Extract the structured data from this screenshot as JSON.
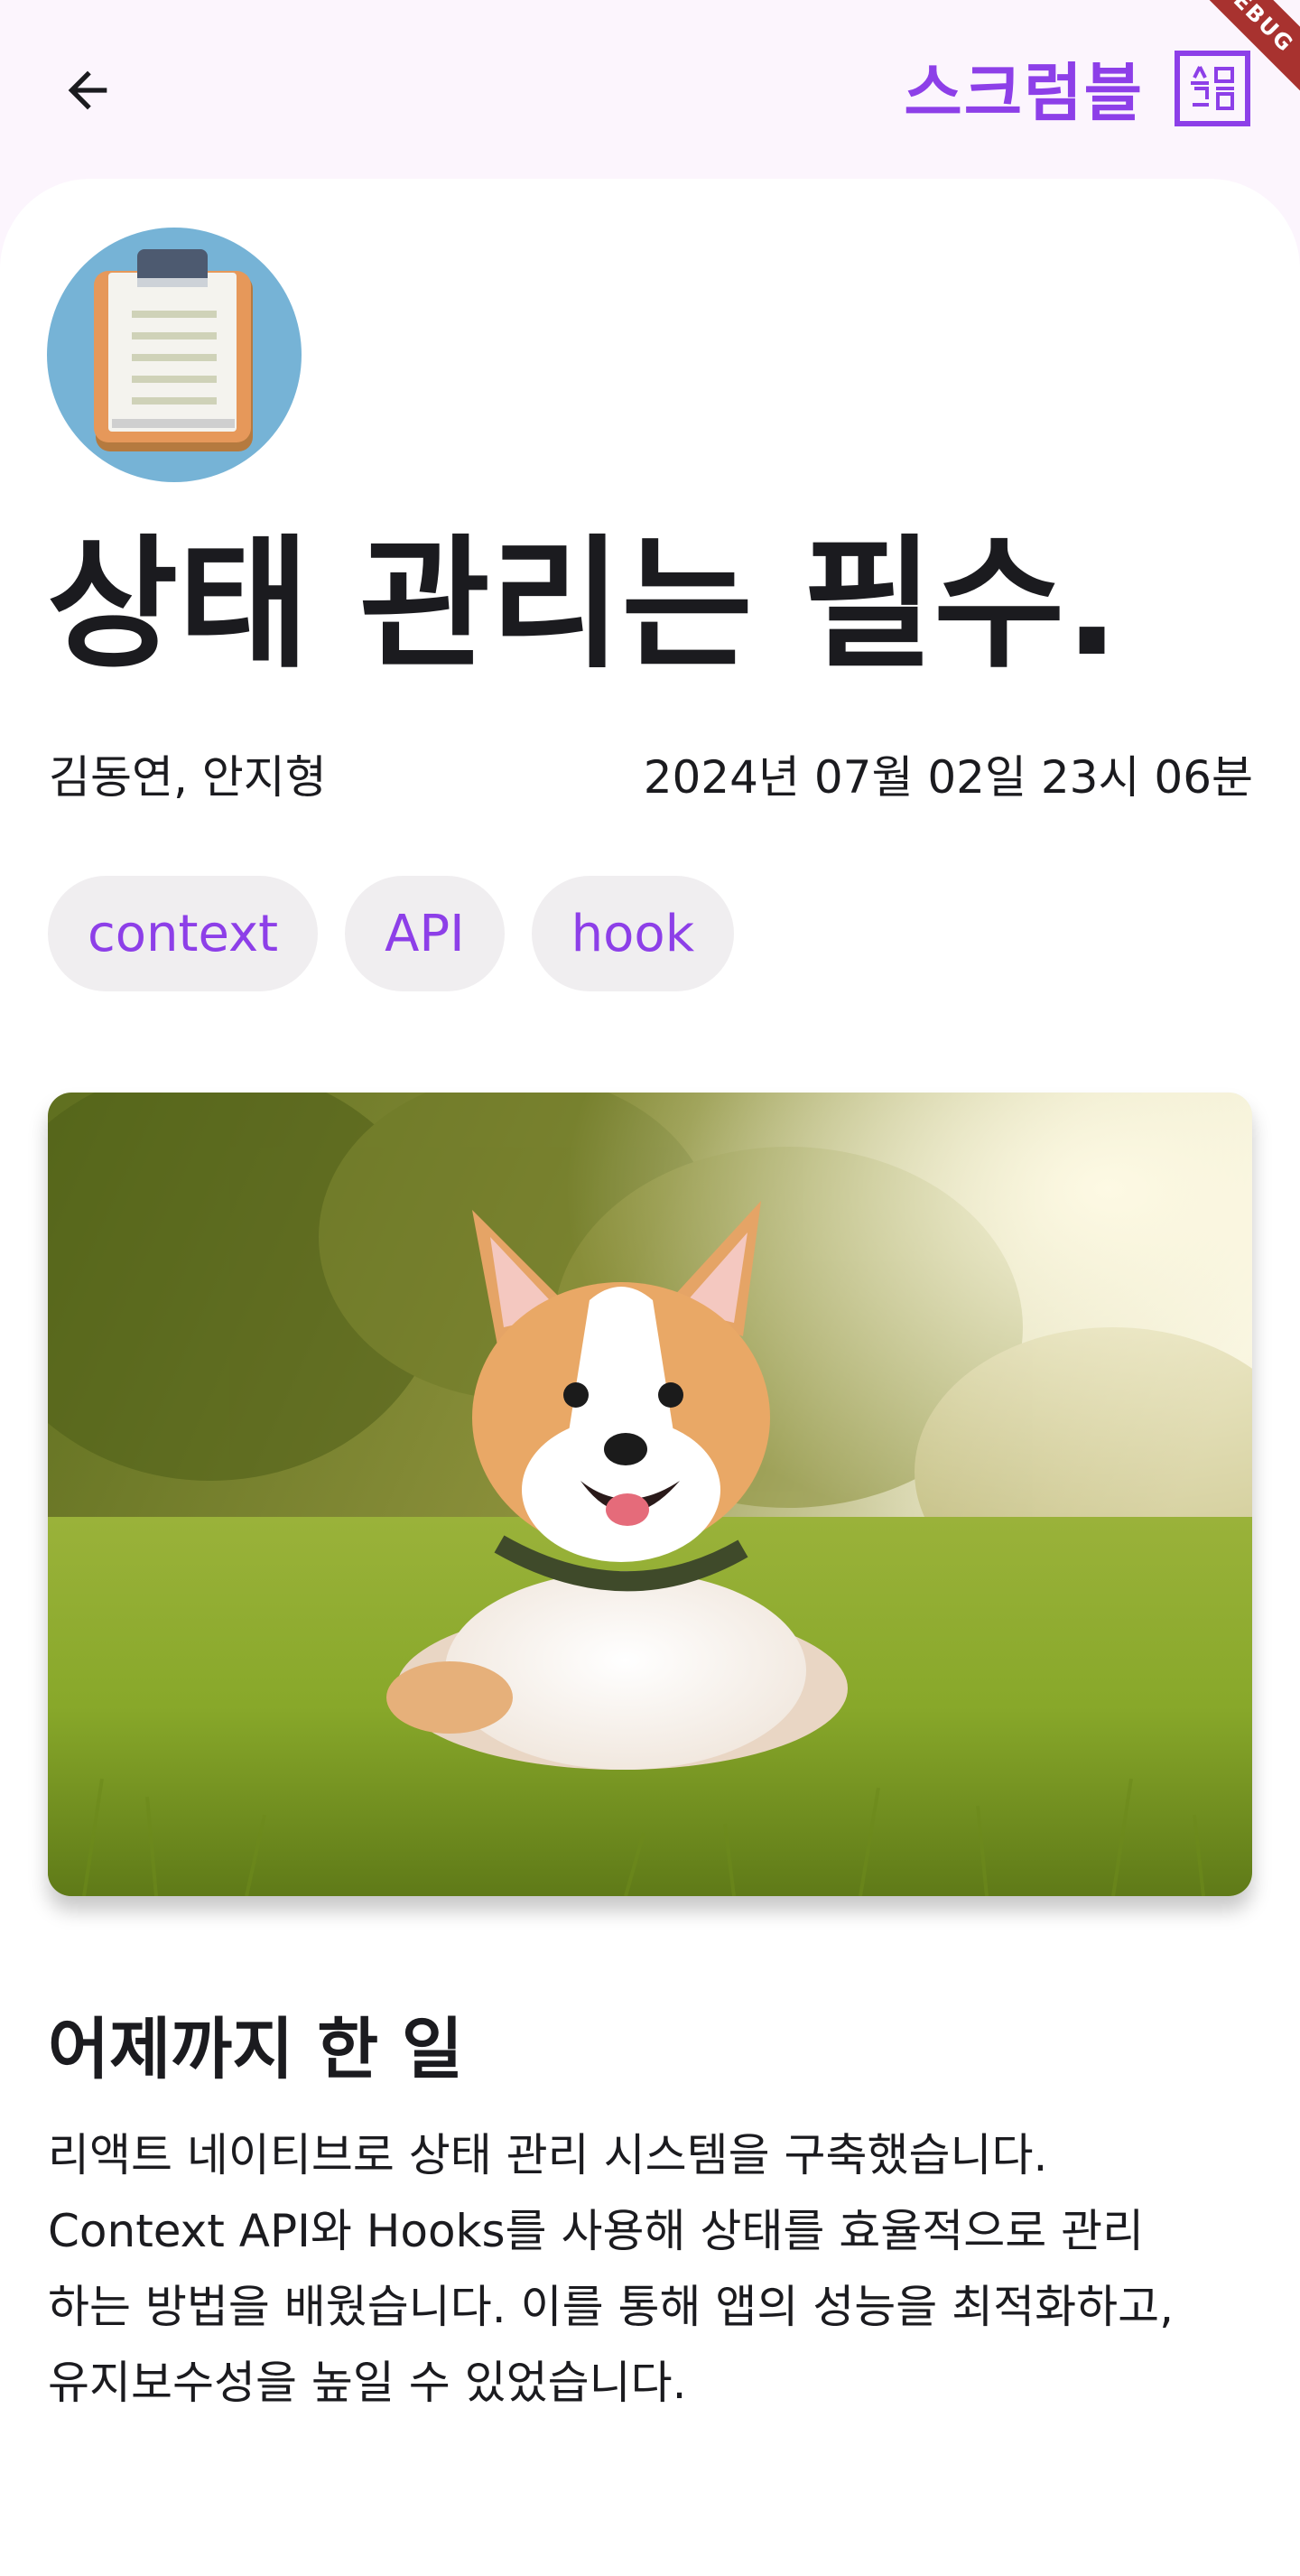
{
  "app_bar": {
    "brand_name": "스크럼블",
    "brand_logo_text": "스크",
    "debug_banner": "DEBUG"
  },
  "icons": {
    "back": "arrow-left-icon",
    "avatar": "clipboard-icon",
    "logo": "scrumble-logo-icon"
  },
  "post": {
    "title": "상태 관리는 필수.",
    "authors": "김동연, 안지형",
    "date": "2024년 07월 02일 23시 06분",
    "tags": [
      "context",
      "API",
      "hook"
    ],
    "image_subject": "corgi dog lying in grass",
    "section_title": "어제까지 한 일",
    "body_lines": [
      "리액트 네이티브로 상태 관리 시스템을 구축했습니다.",
      "Context API와 Hooks를 사용해 상태를 효율적으로 관리",
      "하는 방법을 배웠습니다. 이를 통해 앱의 성능을 최적화하고,",
      "유지보수성을 높일 수 있었습니다."
    ]
  },
  "colors": {
    "accent": "#8d3fe8",
    "background": "#fcf5fd",
    "card": "#ffffff",
    "tag_bg": "#f0eef0",
    "text": "#1b1b1f",
    "avatar_bg": "#76b3d6",
    "debug_banner": "#a8322f"
  }
}
